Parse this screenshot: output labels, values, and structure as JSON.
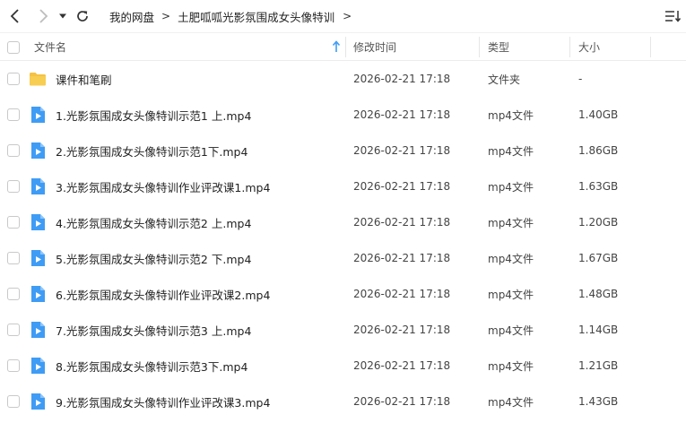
{
  "breadcrumb": {
    "root": "我的网盘",
    "separator": ">",
    "current": "土肥呱呱光影氛围成女头像特训",
    "trailing": ">"
  },
  "toolbar": {
    "back_icon": "chevron-left-icon",
    "forward_icon": "chevron-right-icon",
    "history_icon": "caret-down-icon",
    "refresh_icon": "refresh-icon",
    "sort_icon": "sort-list-icon"
  },
  "columns": {
    "name": "文件名",
    "modified": "修改时间",
    "type": "类型",
    "size": "大小"
  },
  "colors": {
    "folder": "#f5c242",
    "video": "#3f9cf5",
    "sort_arrow": "#3f9cf5"
  },
  "files": [
    {
      "name": "课件和笔刷",
      "date": "2026-02-21 17:18",
      "type": "文件夹",
      "size": "-",
      "icon": "folder-icon"
    },
    {
      "name": "1.光影氛围成女头像特训示范1 上.mp4",
      "date": "2026-02-21 17:18",
      "type": "mp4文件",
      "size": "1.40GB",
      "icon": "video-file-icon"
    },
    {
      "name": "2.光影氛围成女头像特训示范1下.mp4",
      "date": "2026-02-21 17:18",
      "type": "mp4文件",
      "size": "1.86GB",
      "icon": "video-file-icon"
    },
    {
      "name": "3.光影氛围成女头像特训作业评改课1.mp4",
      "date": "2026-02-21 17:18",
      "type": "mp4文件",
      "size": "1.63GB",
      "icon": "video-file-icon"
    },
    {
      "name": "4.光影氛围成女头像特训示范2 上.mp4",
      "date": "2026-02-21 17:18",
      "type": "mp4文件",
      "size": "1.20GB",
      "icon": "video-file-icon"
    },
    {
      "name": "5.光影氛围成女头像特训示范2 下.mp4",
      "date": "2026-02-21 17:18",
      "type": "mp4文件",
      "size": "1.67GB",
      "icon": "video-file-icon"
    },
    {
      "name": "6.光影氛围成女头像特训作业评改课2.mp4",
      "date": "2026-02-21 17:18",
      "type": "mp4文件",
      "size": "1.48GB",
      "icon": "video-file-icon"
    },
    {
      "name": "7.光影氛围成女头像特训示范3 上.mp4",
      "date": "2026-02-21 17:18",
      "type": "mp4文件",
      "size": "1.14GB",
      "icon": "video-file-icon"
    },
    {
      "name": "8.光影氛围成女头像特训示范3下.mp4",
      "date": "2026-02-21 17:18",
      "type": "mp4文件",
      "size": "1.21GB",
      "icon": "video-file-icon"
    },
    {
      "name": "9.光影氛围成女头像特训作业评改课3.mp4",
      "date": "2026-02-21 17:18",
      "type": "mp4文件",
      "size": "1.43GB",
      "icon": "video-file-icon"
    }
  ]
}
